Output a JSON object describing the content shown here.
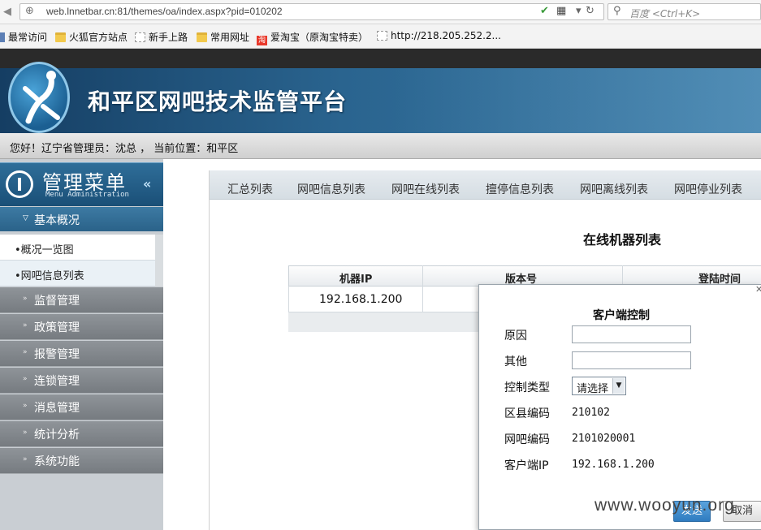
{
  "browser": {
    "url": "web.lnnetbar.cn:81/themes/oa/index.aspx?pid=010202",
    "search_placeholder": "百度 <Ctrl+K>"
  },
  "bookmarks": [
    {
      "label": "最常访问",
      "icon": "gear-icon"
    },
    {
      "label": "火狐官方站点",
      "icon": "folder-icon"
    },
    {
      "label": "新手上路",
      "icon": "page-icon"
    },
    {
      "label": "常用网址",
      "icon": "folder-icon"
    },
    {
      "label": "爱淘宝（原淘宝特卖）",
      "icon": "taobao-icon"
    },
    {
      "label": "http://218.205.252.2...",
      "icon": "page-icon"
    }
  ],
  "header": {
    "title": "和平区网吧技术监管平台"
  },
  "infobar": {
    "text": "您好！辽宁省管理员：沈总  ，  当前位置：和平区"
  },
  "sidebar": {
    "menu_title": "管理菜单",
    "menu_subtitle": "Menu Administration",
    "active_section": "基本概况",
    "sub_items": [
      "•概况一览图",
      "•网吧信息列表"
    ],
    "sections": [
      "监督管理",
      "政策管理",
      "报警管理",
      "连锁管理",
      "消息管理",
      "统计分析",
      "系统功能"
    ]
  },
  "tabs": [
    "汇总列表",
    "网吧信息列表",
    "网吧在线列表",
    "擅停信息列表",
    "网吧离线列表",
    "网吧停业列表"
  ],
  "list": {
    "title": "在线机器列表",
    "columns": [
      "机器IP",
      "版本号",
      "登陆时间"
    ],
    "rows": [
      [
        "192.168.1.200",
        "",
        ""
      ]
    ]
  },
  "dialog": {
    "title": "客户端控制",
    "reason_label": "原因",
    "other_label": "其他",
    "type_label": "控制类型",
    "type_value": "请选择",
    "district_label": "区县编码",
    "district_value": "210102",
    "netbar_label": "网吧编码",
    "netbar_value": "2101020001",
    "ip_label": "客户端IP",
    "ip_value": "192.168.1.200",
    "send_label": "发送",
    "cancel_label": "取消"
  },
  "watermark": "www.wooyun.org",
  "colors": {
    "banner": "#1e5a86",
    "menu_active": "#2a6289",
    "send_button": "#2f7cc0"
  }
}
